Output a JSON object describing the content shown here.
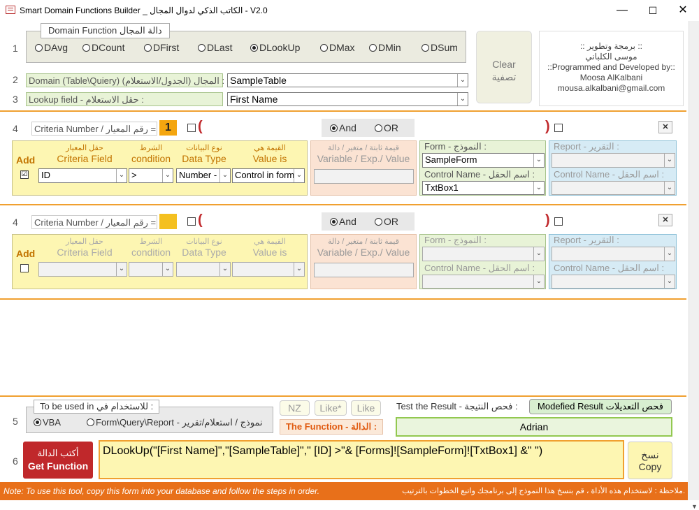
{
  "window": {
    "title": "Smart Domain Functions Builder _ الكاتب الذكي لدوال المجال  -  V2.0",
    "min": "—",
    "max": "☐",
    "close": "✕"
  },
  "row_numbers": [
    "1",
    "2",
    "3",
    "4",
    "4",
    "5",
    "6"
  ],
  "domain_function": {
    "legend": "Domain Function   دالة المجال",
    "options": [
      "DAvg",
      "DCount",
      "DFirst",
      "DLast",
      "DLookUp",
      "DMax",
      "DMin",
      "DSum"
    ],
    "selected": "DLookUp"
  },
  "clear_button": {
    "en": "Clear",
    "ar": "تصفية"
  },
  "author": {
    "line1": ":: برمجة وتطوير ::",
    "line2": "موسى الكلباني",
    "line3": "::Programmed and Developed by::",
    "line4": "Moosa AlKalbani",
    "line5": "mousa.alkalbani@gmail.com"
  },
  "domain_field": {
    "label": "Domain (Table\\Quiery) (المجال (الجدول/الاستعلام :",
    "value": "SampleTable"
  },
  "lookup_field": {
    "label": "Lookup field  -  حقل الاستعلام :",
    "value": "First Name"
  },
  "criteria1": {
    "number_label": "Criteria Number / رقم المعيار =",
    "number": "1",
    "paren_open": "(",
    "paren_close": ")",
    "and": "And",
    "or": "OR",
    "close": "✕",
    "add": "Add",
    "field_ar": "حقل المعيار",
    "field_en": "Criteria Field",
    "cond_ar": "الشرط",
    "cond_en": "condition",
    "type_ar": "نوع البيانات",
    "type_en": "Data Type",
    "val_ar": "القيمة هي",
    "val_en": "Value is",
    "var_ar": "قيمة ثابتة / متغير / دالة",
    "var_en": "Variable / Exp./ Value",
    "form_label": "Form  -  النموذج :",
    "form_value": "SampleForm",
    "control_label": "Control Name  -  اسم الحقل :",
    "control_value": "TxtBox1",
    "report_label": "Report  -  التقرير :",
    "report_control_label": "Control Name  -  اسم الحقل :",
    "field_value": "ID",
    "cond_value": ">",
    "type_value": "Number -",
    "val_value": "Control in form",
    "checked": "☑"
  },
  "criteria2": {
    "number_label": "Criteria Number / رقم المعيار =",
    "paren_open": "(",
    "paren_close": ")",
    "and": "And",
    "or": "OR",
    "close": "✕",
    "add": "Add",
    "field_ar": "حقل المعيار",
    "field_en": "Criteria Field",
    "cond_ar": "الشرط",
    "cond_en": "condition",
    "type_ar": "نوع البيانات",
    "type_en": "Data Type",
    "val_ar": "القيمة هي",
    "val_en": "Value is",
    "var_ar": "قيمة ثابتة / متغير / دالة",
    "var_en": "Variable / Exp./ Value",
    "form_label": "Form  -  النموذج :",
    "control_label": "Control Name  -  اسم الحقل :",
    "report_label": "Report  -  التقرير :",
    "report_control_label": "Control Name  -  اسم الحقل :"
  },
  "usage": {
    "legend": "To be used in   للاستخدام في :",
    "vba": "VBA",
    "form": "Form\\Query\\Report - نموذج / استعلام/تقرير",
    "selected": "VBA"
  },
  "nz": "NZ",
  "like_star": "Like*",
  "like": "Like",
  "function_label": "The Function - الدالة :",
  "test_label": "Test the Result  -  فحص النتيجة :",
  "modified_button": "Modefied Result فحص التعديلات",
  "result": "Adrian",
  "get_function": {
    "ar": "أكتب الدالة",
    "en": "Get Function"
  },
  "function_text": "DLookUp(\"[First Name]\",\"[SampleTable]\",\" [ID] >\"& [Forms]![SampleForm]![TxtBox1] &\" \")",
  "copy": {
    "ar": "نسخ",
    "en": "Copy"
  },
  "footer": {
    "en": "Note: To use this tool, copy this form into your database and follow the steps in order.",
    "ar": "ملاحظة : لاستخدام هذه الأداة ، قم بنسخ هذا النموذج إلى برنامجك واتبع الخطوات بالترتيب."
  },
  "colors": {
    "orange": "#f0a030",
    "red_button": "#c0282b",
    "footer_bg": "#e8701a"
  }
}
